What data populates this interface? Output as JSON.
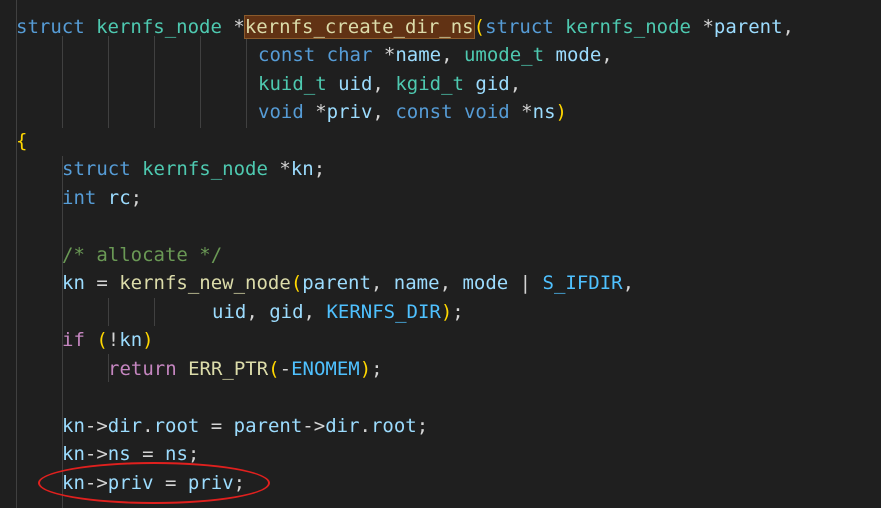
{
  "editor": {
    "accent_color": "#e0201e",
    "code": {
      "l1_kw": "struct",
      "l1_type": "kernfs_node",
      "l1_star": " *",
      "l1_fn": "kernfs_create_dir_ns",
      "l1_paren": "(",
      "l1_kw2": "struct",
      "l1_type2": "kernfs_node",
      "l1_star2": " *",
      "l1_var": "parent",
      "l1_comma": ",",
      "l2_kw": "const",
      "l2_kw2": "char",
      "l2_star": " *",
      "l2_var": "name",
      "l2_comma": ", ",
      "l2_type": "umode_t",
      "l2_var2": "mode",
      "l2_end": ",",
      "l3_type": "kuid_t",
      "l3_var": "uid",
      "l3_comma": ", ",
      "l3_type2": "kgid_t",
      "l3_var2": "gid",
      "l3_end": ",",
      "l4_kw": "void",
      "l4_star": " *",
      "l4_var": "priv",
      "l4_comma": ", ",
      "l4_kw2": "const",
      "l4_kw3": "void",
      "l4_star2": " *",
      "l4_var2": "ns",
      "l4_paren": ")",
      "l5_brace": "{",
      "l6_kw": "struct",
      "l6_type": "kernfs_node",
      "l6_star": " *",
      "l6_var": "kn",
      "l6_semi": ";",
      "l7_kw": "int",
      "l7_var": "rc",
      "l7_semi": ";",
      "l9_comment": "/* allocate */",
      "l10_var": "kn",
      "l10_eq": " = ",
      "l10_fn": "kernfs_new_node",
      "l10_paren": "(",
      "l10_var2": "parent",
      "l10_comma": ", ",
      "l10_var3": "name",
      "l10_comma2": ", ",
      "l10_var4": "mode",
      "l10_pipe": " | ",
      "l10_const": "S_IFDIR",
      "l10_end": ",",
      "l11_var": "uid",
      "l11_comma": ", ",
      "l11_var2": "gid",
      "l11_comma2": ", ",
      "l11_const": "KERNFS_DIR",
      "l11_paren": ")",
      "l11_semi": ";",
      "l12_kw": "if",
      "l12_paren": "(",
      "l12_not": "!",
      "l12_var": "kn",
      "l12_paren2": ")",
      "l13_kw": "return",
      "l13_fn": "ERR_PTR",
      "l13_paren": "(",
      "l13_minus": "-",
      "l13_const": "ENOMEM",
      "l13_paren2": ")",
      "l13_semi": ";",
      "l15_var": "kn",
      "l15_arrow": "->",
      "l15_var2": "dir",
      "l15_dot": ".",
      "l15_var3": "root",
      "l15_eq": " = ",
      "l15_var4": "parent",
      "l15_arrow2": "->",
      "l15_var5": "dir",
      "l15_dot2": ".",
      "l15_var6": "root",
      "l15_semi": ";",
      "l16_var": "kn",
      "l16_arrow": "->",
      "l16_var2": "ns",
      "l16_eq": " = ",
      "l16_var3": "ns",
      "l16_semi": ";",
      "l17_var": "kn",
      "l17_arrow": "->",
      "l17_var2": "priv",
      "l17_eq": " = ",
      "l17_var3": "priv",
      "l17_semi": ";"
    }
  }
}
